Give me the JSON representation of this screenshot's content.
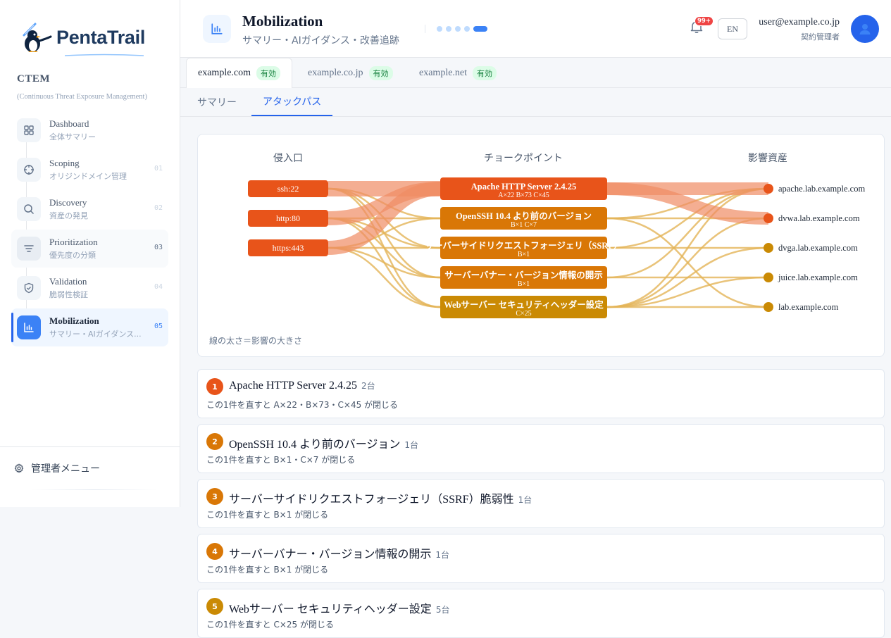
{
  "sidebar": {
    "logo": "PentaTrail",
    "product": "CTEM",
    "product_sub": "(Continuous Threat Exposure Management)",
    "items": [
      {
        "title": "Dashboard",
        "sub": "全体サマリー",
        "num": ""
      },
      {
        "title": "Scoping",
        "sub": "オリジンドメイン管理",
        "num": "01"
      },
      {
        "title": "Discovery",
        "sub": "資産の発見",
        "num": "02"
      },
      {
        "title": "Prioritization",
        "sub": "優先度の分類",
        "num": "03"
      },
      {
        "title": "Validation",
        "sub": "脆弱性検証",
        "num": "04"
      },
      {
        "title": "Mobilization",
        "sub": "サマリー・AIガイダンス...",
        "num": "05"
      }
    ],
    "admin": "管理者メニュー"
  },
  "header": {
    "title": "Mobilization",
    "subtitle": "サマリー・AIガイダンス・改善追跡",
    "notif": "99+",
    "lang": "EN",
    "user_email": "user@example.co.jp",
    "user_role": "契約管理者"
  },
  "domain_tabs": [
    {
      "label": "example.com",
      "status": "有効"
    },
    {
      "label": "example.co.jp",
      "status": "有効"
    },
    {
      "label": "example.net",
      "status": "有効"
    }
  ],
  "view_tabs": [
    "サマリー",
    "アタックパス"
  ],
  "graph": {
    "col_entry": "侵入口",
    "col_choke": "チョークポイント",
    "col_asset": "影響資産",
    "legend": "線の太さ＝影響の大きさ",
    "entries": [
      "ssh:22",
      "http:80",
      "https:443"
    ],
    "chokes": [
      {
        "label": "Apache HTTP Server 2.4.25",
        "sub": "A×22 B×73 C×45",
        "color": "#e8541a"
      },
      {
        "label": "OpenSSH 10.4 より前のバージョン",
        "sub": "B×1 C×7",
        "color": "#d97706"
      },
      {
        "label": "サーバーサイドリクエストフォージェリ（SSRF）",
        "sub": "B×1",
        "color": "#d97706"
      },
      {
        "label": "サーバーバナー・バージョン情報の開示",
        "sub": "B×1",
        "color": "#d97706"
      },
      {
        "label": "Webサーバー セキュリティヘッダー設定",
        "sub": "C×25",
        "color": "#ca8a04"
      }
    ],
    "assets": [
      {
        "label": "apache.lab.example.com",
        "color": "#e8541a"
      },
      {
        "label": "dvwa.lab.example.com",
        "color": "#e8541a"
      },
      {
        "label": "dvga.lab.example.com",
        "color": "#ca8a04"
      },
      {
        "label": "juice.lab.example.com",
        "color": "#ca8a04"
      },
      {
        "label": "lab.example.com",
        "color": "#ca8a04"
      }
    ]
  },
  "findings": [
    {
      "num": "1",
      "title": "Apache HTTP Server 2.4.25",
      "count": "2台",
      "desc": "この1件を直すと A×22・B×73・C×45 が閉じる",
      "color": "#e8541a"
    },
    {
      "num": "2",
      "title": "OpenSSH 10.4 より前のバージョン",
      "count": "1台",
      "desc": "この1件を直すと B×1・C×7 が閉じる",
      "color": "#d97706"
    },
    {
      "num": "3",
      "title": "サーバーサイドリクエストフォージェリ（SSRF）脆弱性",
      "count": "1台",
      "desc": "この1件を直すと B×1 が閉じる",
      "color": "#d97706"
    },
    {
      "num": "4",
      "title": "サーバーバナー・バージョン情報の開示",
      "count": "1台",
      "desc": "この1件を直すと B×1 が閉じる",
      "color": "#d97706"
    },
    {
      "num": "5",
      "title": "Webサーバー セキュリティヘッダー設定",
      "count": "5台",
      "desc": "この1件を直すと C×25 が閉じる",
      "color": "#ca8a04"
    }
  ]
}
